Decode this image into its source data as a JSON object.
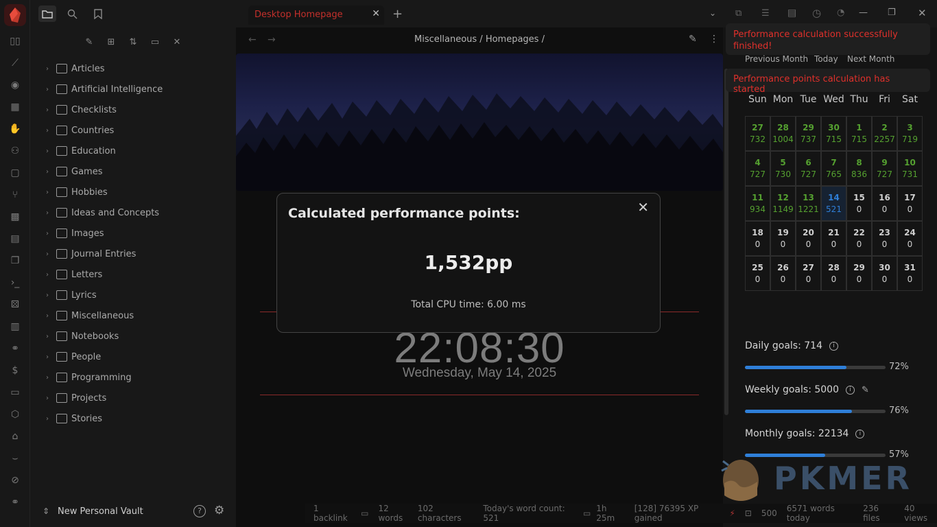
{
  "tab": {
    "title": "Desktop Homepage"
  },
  "breadcrumb": "Miscellaneous / Homepages /",
  "sidebar": {
    "items": [
      {
        "label": "Articles",
        "icon": "newspaper-icon"
      },
      {
        "label": "Artificial Intelligence",
        "icon": "bot-icon"
      },
      {
        "label": "Checklists",
        "icon": "checklist-icon"
      },
      {
        "label": "Countries",
        "icon": "flag-icon"
      },
      {
        "label": "Education",
        "icon": "book-icon"
      },
      {
        "label": "Games",
        "icon": "gamepad-icon"
      },
      {
        "label": "Hobbies",
        "icon": "infinity-icon"
      },
      {
        "label": "Ideas and Concepts",
        "icon": "lightbulb-icon"
      },
      {
        "label": "Images",
        "icon": "image-icon"
      },
      {
        "label": "Journal Entries",
        "icon": "journal-icon"
      },
      {
        "label": "Letters",
        "icon": "letter-icon"
      },
      {
        "label": "Lyrics",
        "icon": "lyrics-icon"
      },
      {
        "label": "Miscellaneous",
        "icon": "gear-icon"
      },
      {
        "label": "Notebooks",
        "icon": "notebook-icon"
      },
      {
        "label": "People",
        "icon": "person-icon"
      },
      {
        "label": "Programming",
        "icon": "code-icon"
      },
      {
        "label": "Projects",
        "icon": "projects-icon"
      },
      {
        "label": "Stories",
        "icon": "stories-icon"
      }
    ],
    "vault": "New Personal Vault"
  },
  "modal": {
    "title": "Calculated performance points:",
    "value": "1,532pp",
    "cpu": "Total CPU time: 6.00 ms"
  },
  "clock": {
    "time": "22:08:30",
    "date": "Wednesday, May 14, 2025"
  },
  "notices": {
    "first": "Performance calculation successfully finished!",
    "second": "Performance points calculation has started"
  },
  "calendar": {
    "nav": {
      "prev": "Previous Month",
      "today": "Today",
      "next": "Next Month"
    },
    "days": [
      "Sun",
      "Mon",
      "Tue",
      "Wed",
      "Thu",
      "Fri",
      "Sat"
    ],
    "weeks": [
      [
        [
          "27",
          "732"
        ],
        [
          "28",
          "1004"
        ],
        [
          "29",
          "737"
        ],
        [
          "30",
          "715"
        ],
        [
          "1",
          "715"
        ],
        [
          "2",
          "2257"
        ],
        [
          "3",
          "719"
        ]
      ],
      [
        [
          "4",
          "727"
        ],
        [
          "5",
          "730"
        ],
        [
          "6",
          "727"
        ],
        [
          "7",
          "765"
        ],
        [
          "8",
          "836"
        ],
        [
          "9",
          "727"
        ],
        [
          "10",
          "731"
        ]
      ],
      [
        [
          "11",
          "934"
        ],
        [
          "12",
          "1149"
        ],
        [
          "13",
          "1221"
        ],
        [
          "14",
          "521"
        ],
        [
          "15",
          "0"
        ],
        [
          "16",
          "0"
        ],
        [
          "17",
          "0"
        ]
      ],
      [
        [
          "18",
          "0"
        ],
        [
          "19",
          "0"
        ],
        [
          "20",
          "0"
        ],
        [
          "21",
          "0"
        ],
        [
          "22",
          "0"
        ],
        [
          "23",
          "0"
        ],
        [
          "24",
          "0"
        ]
      ],
      [
        [
          "25",
          "0"
        ],
        [
          "26",
          "0"
        ],
        [
          "27",
          "0"
        ],
        [
          "28",
          "0"
        ],
        [
          "29",
          "0"
        ],
        [
          "30",
          "0"
        ],
        [
          "31",
          "0"
        ]
      ]
    ]
  },
  "goals": {
    "daily": {
      "label": "Daily goals: 714",
      "pct": "72%",
      "fraction": 0.72
    },
    "weekly": {
      "label": "Weekly goals: 5000",
      "pct": "76%",
      "fraction": 0.76
    },
    "monthly": {
      "label": "Monthly goals: 22134",
      "pct": "57%",
      "fraction": 0.57
    }
  },
  "status": {
    "backlinks": "1 backlink",
    "words": "12 words",
    "characters": "102 characters",
    "today_words": "Today's word count: 521",
    "time": "1h 25m",
    "xp": "[128] 76395 XP gained",
    "points": "500",
    "words_today": "6571 words today",
    "files": "236 files",
    "views": "40 views"
  },
  "watermark": "PKMER",
  "colors": {
    "accent_red": "#e0302b",
    "done_green": "#55a130",
    "today_blue": "#2f7fd8",
    "progress_blue": "#2f7fd8"
  }
}
